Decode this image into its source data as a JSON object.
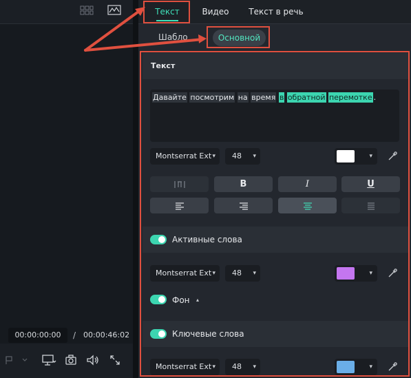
{
  "player": {
    "current_time": "00:00:00:00",
    "separator": "/",
    "total_time": "00:00:46:02"
  },
  "tabs": [
    "Текст",
    "Видео",
    "Текст в речь"
  ],
  "subtabs": {
    "templates_label": "Шабло",
    "basic_label": "Основной"
  },
  "text_section": {
    "title": "Текст",
    "content_plain": [
      "Давайте",
      "посмотрим",
      "на",
      "время"
    ],
    "content_highlighted": [
      "в",
      "обратной",
      "перемотке"
    ],
    "content_end": "."
  },
  "font_row_1": {
    "font": "Montserrat Ext",
    "size": "48",
    "color": "#ffffff"
  },
  "active_words": {
    "label": "Активные слова",
    "font": "Montserrat Ext",
    "size": "48",
    "color": "#c476f0",
    "bg_label": "Фон"
  },
  "keywords": {
    "label": "Ключевые слова",
    "font": "Montserrat Ext",
    "size": "48",
    "color": "#6aaee8"
  },
  "icons": {
    "bold": "B",
    "italic": "I",
    "underline": "U",
    "chevron": "▾",
    "collapse": "▴"
  },
  "colors": {
    "accent": "#3fe0b9",
    "annotation": "#e0503f"
  }
}
